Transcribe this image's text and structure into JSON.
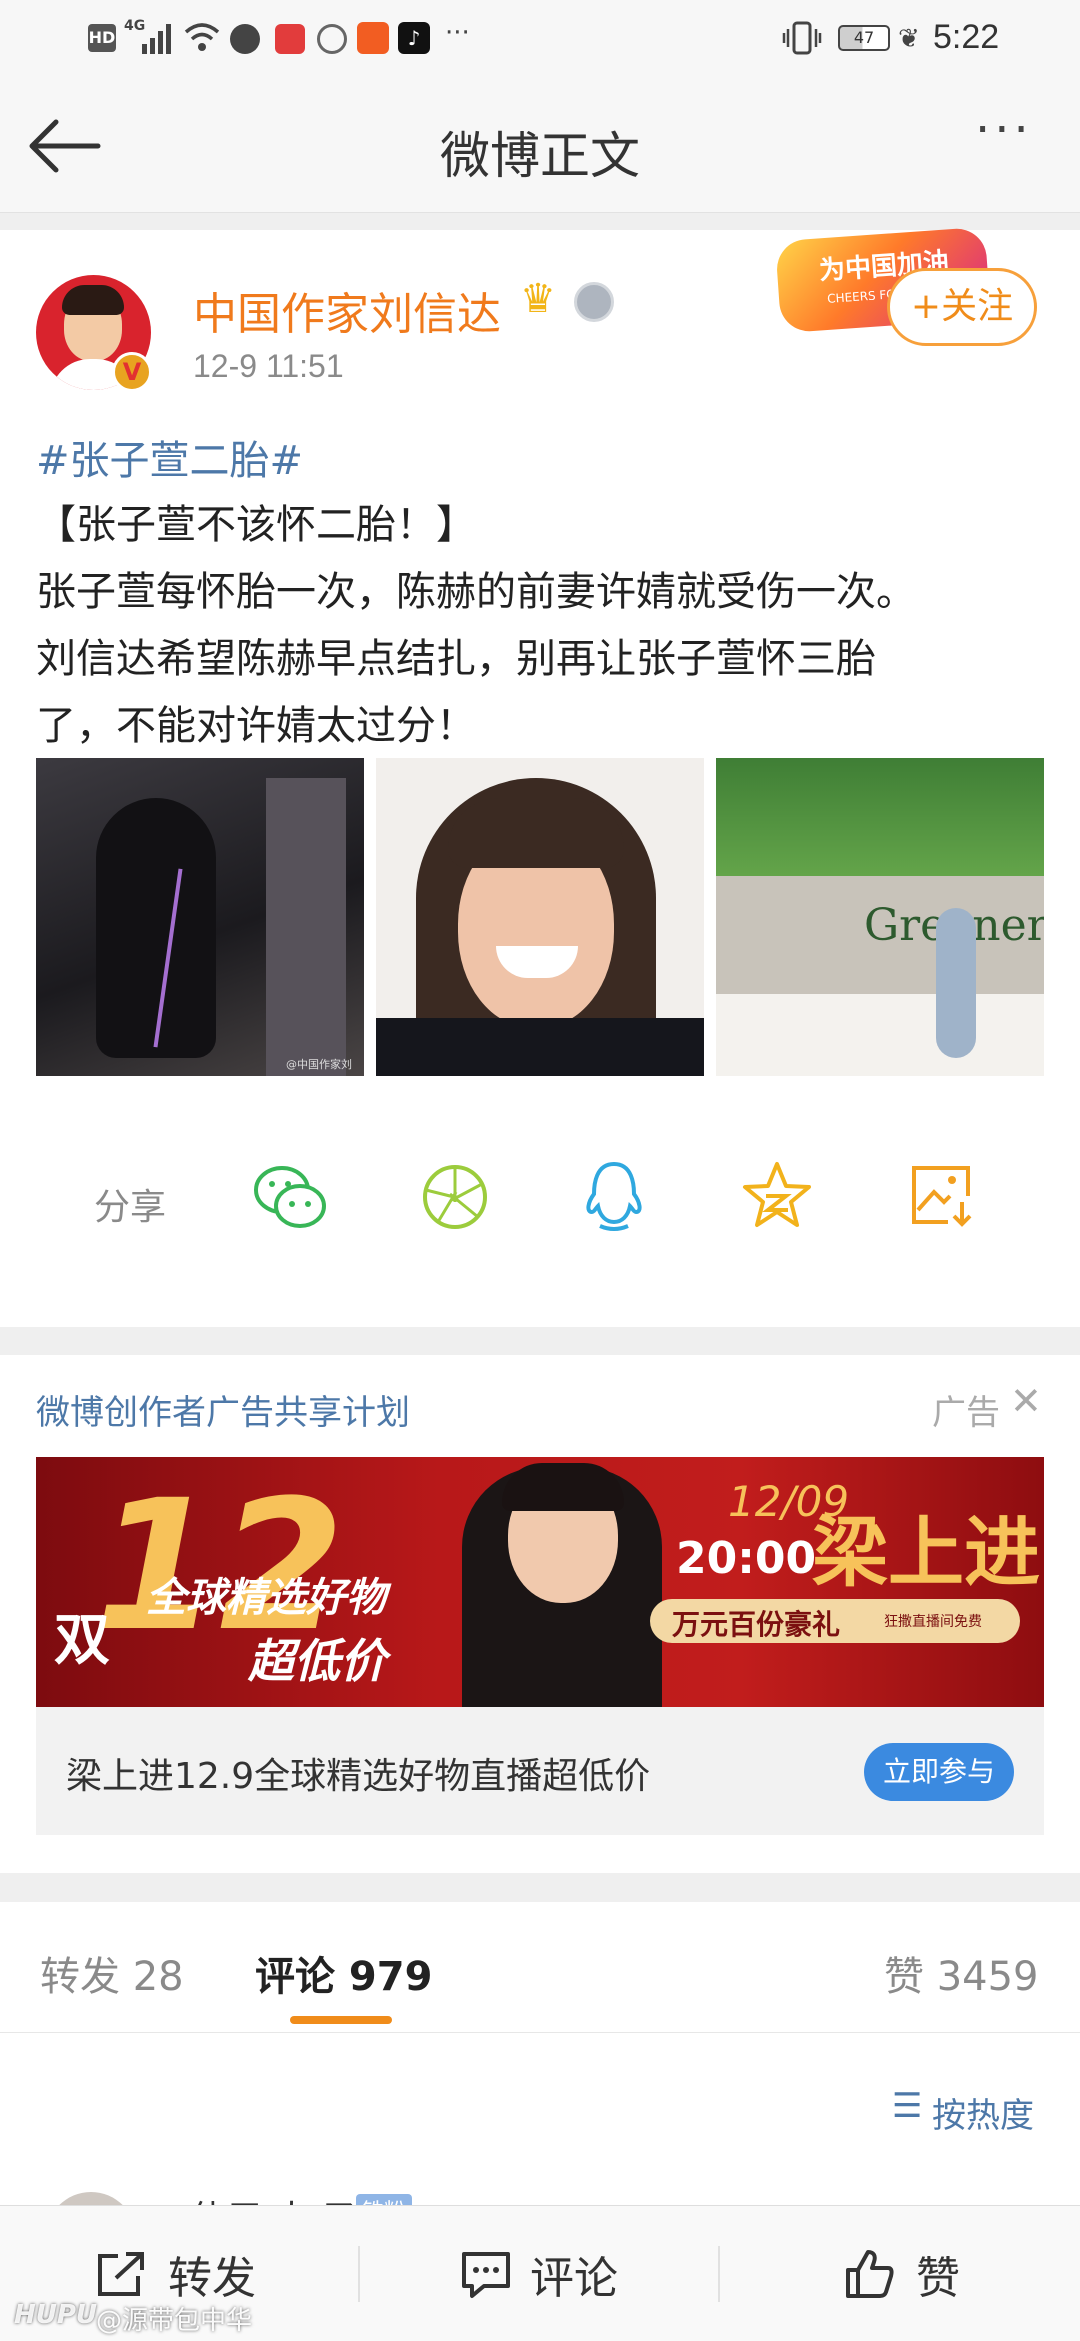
{
  "status_bar": {
    "hd": "HD",
    "network": "4G",
    "battery": "47",
    "time": "5:22",
    "more": "···"
  },
  "nav": {
    "title": "微博正文",
    "more": "···"
  },
  "post": {
    "author": "中国作家刘信达",
    "time": "12-9 11:51",
    "follow_label": "+关注",
    "badge_text": "为中国加油",
    "badge_sub": "CHEERS FOR",
    "hashtag": "#张子萱二胎#",
    "lines": [
      "【张子萱不该怀二胎！】",
      "张子萱每怀胎一次，陈赫的前妻许婧就受伤一次。",
      "刘信达希望陈赫早点结扎，别再让张子萱怀三胎",
      "了，不能对许婧太过分！"
    ],
    "image3_text": "Greener",
    "image1_watermark": "@中国作家刘"
  },
  "share": {
    "label": "分享",
    "icons": [
      "wechat-icon",
      "moments-icon",
      "qq-icon",
      "qzone-icon",
      "save-image-icon"
    ]
  },
  "ad": {
    "title": "微博创作者广告共享计划",
    "tag": "广告",
    "banner": {
      "big_number": "12",
      "prefix": "双",
      "line1": "全球精选好物",
      "line2": "超低价",
      "date": "12/09",
      "time": "20:00",
      "name": "梁上进",
      "gift": "万元百份豪礼",
      "gift_sub": "狂撒直播间免费"
    },
    "caption": "梁上进12.9全球精选好物直播超低价",
    "cta": "立即参与"
  },
  "tabs": {
    "repost": "转发 28",
    "comment": "评论 979",
    "like": "赞 3459",
    "sort": "按热度"
  },
  "comment_preview": {
    "name": "使用 大 子",
    "badge": "铁粉"
  },
  "toolbar": {
    "repost": "转发",
    "comment": "评论",
    "like": "赞"
  },
  "watermark": {
    "brand": "HUPU",
    "user": "@源带包中华"
  },
  "colors": {
    "accent_orange": "#f08c1a",
    "name_orange": "#f07a1c",
    "link_blue": "#4d78a8",
    "cta_blue": "#3b8ae0"
  }
}
